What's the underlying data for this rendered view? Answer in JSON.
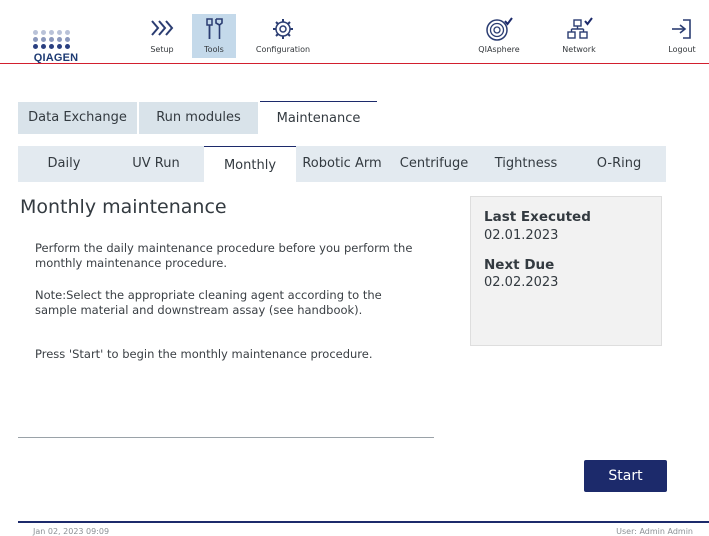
{
  "brand": {
    "logo_text": "QIAGEN"
  },
  "nav": {
    "setup": "Setup",
    "tools": "Tools",
    "configuration": "Configuration",
    "qiasphere": "QIAsphere",
    "network": "Network",
    "logout": "Logout"
  },
  "top_tabs": [
    "Data Exchange",
    "Run modules",
    "Maintenance"
  ],
  "sub_tabs": [
    "Daily",
    "UV Run",
    "Monthly",
    "Robotic Arm",
    "Centrifuge",
    "Tightness",
    "O-Ring"
  ],
  "main": {
    "title": "Monthly maintenance",
    "paragraphs": [
      "Perform the daily maintenance procedure before you perform the monthly maintenance procedure.",
      "Note:Select the appropriate cleaning agent according to the sample material and downstream assay (see handbook).",
      "Press 'Start' to begin the monthly maintenance procedure."
    ]
  },
  "info": {
    "last_executed_label": "Last Executed",
    "last_executed_value": "02.01.2023",
    "next_due_label": "Next Due",
    "next_due_value": "02.02.2023"
  },
  "actions": {
    "start": "Start"
  },
  "footer": {
    "datetime": "Jan 02, 2023 09:09",
    "user": "User: Admin Admin"
  },
  "colors": {
    "accent": "#1c2a6b",
    "brand_red": "#d21f2e",
    "tab_bg": "#d9e3ea",
    "active_nav_bg": "#c4d9ea"
  }
}
